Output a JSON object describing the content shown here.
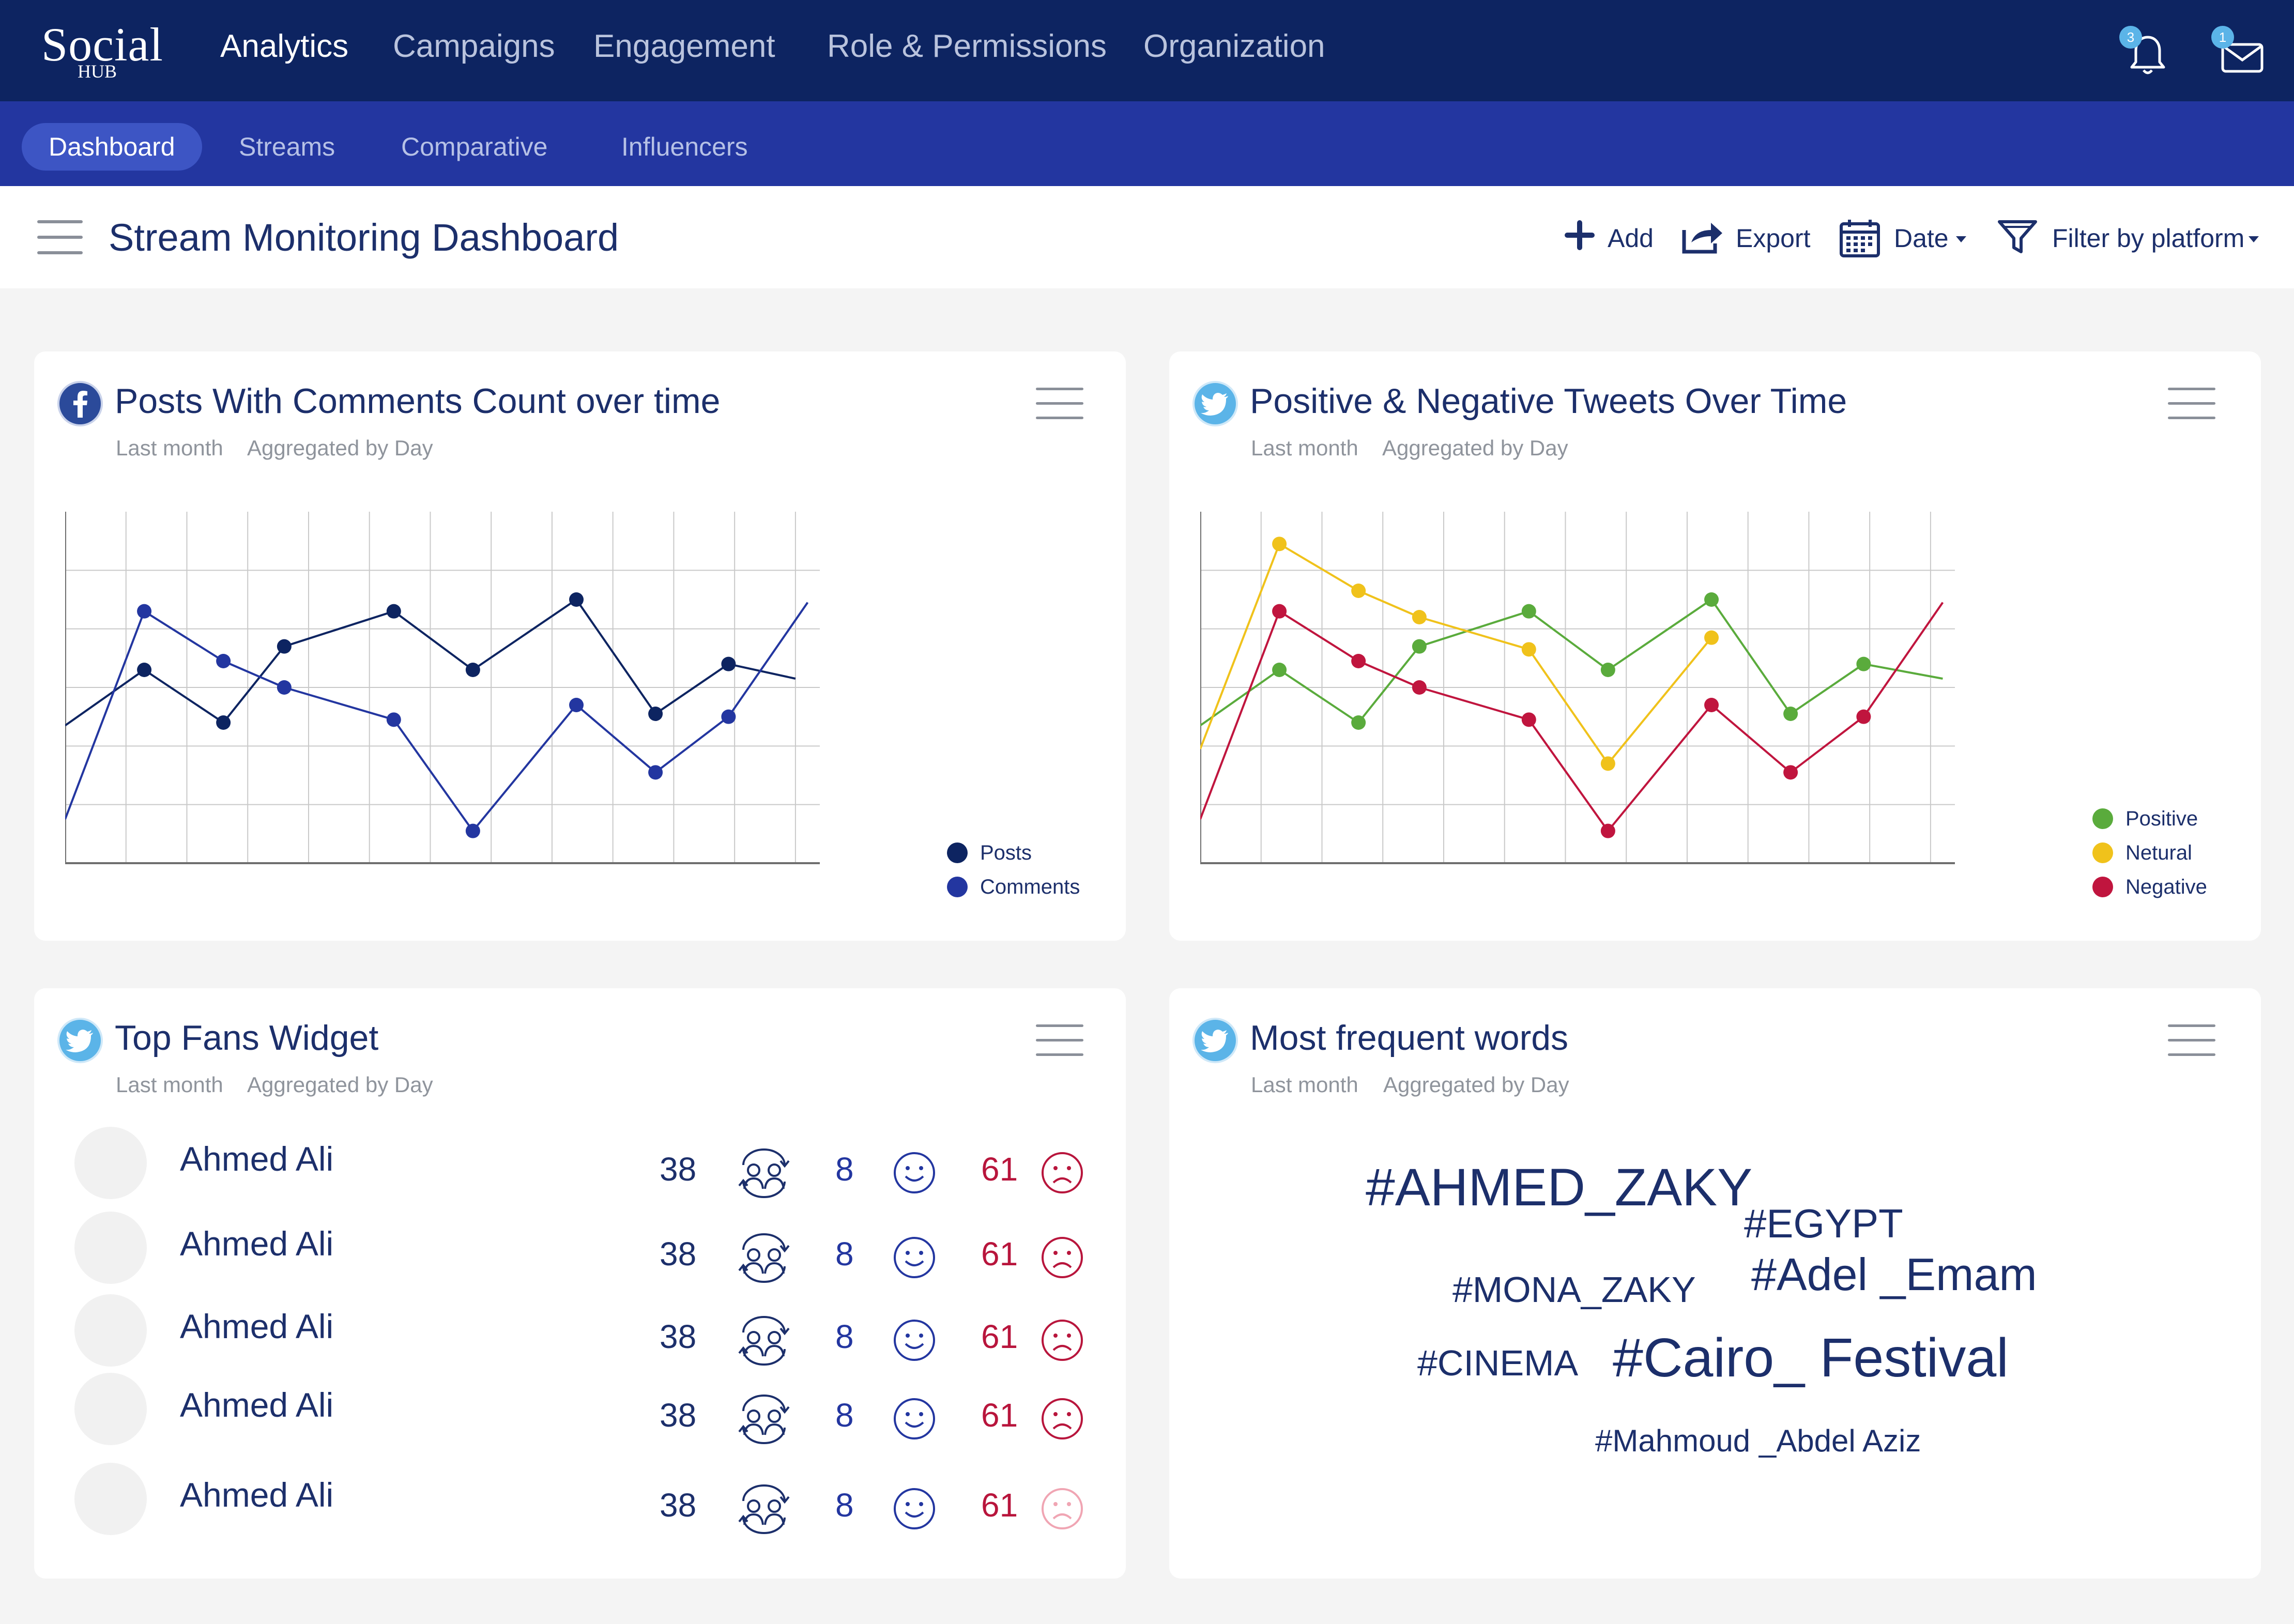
{
  "brand": {
    "logo_main": "Social",
    "logo_sub": "HUB"
  },
  "top_nav": {
    "items": [
      "Analytics",
      "Campaigns",
      "Engagement",
      "Role & Permissions",
      "Organization"
    ],
    "notifications_count": "3",
    "messages_count": "1"
  },
  "sub_nav": {
    "items": [
      "Dashboard",
      "Streams",
      "Comparative",
      "Influencers"
    ]
  },
  "page": {
    "title": "Stream Monitoring Dashboard",
    "actions": {
      "add": "Add",
      "export": "Export",
      "date": "Date",
      "filter": "Filter by platform"
    }
  },
  "cards": {
    "posts_comments": {
      "platform": "facebook",
      "title": "Posts With Comments Count over time",
      "period": "Last month",
      "aggregation": "Aggregated by Day"
    },
    "tweets_sentiment": {
      "platform": "twitter",
      "title": "Positive & Negative Tweets Over Time",
      "period": "Last month",
      "aggregation": "Aggregated by Day"
    },
    "top_fans": {
      "platform": "twitter",
      "title": "Top Fans Widget",
      "period": "Last month",
      "aggregation": "Aggregated by Day"
    },
    "frequent_words": {
      "platform": "twitter",
      "title": "Most frequent words",
      "period": "Last month",
      "aggregation": "Aggregated by Day"
    }
  },
  "chart_data": [
    {
      "type": "line",
      "x": [
        0,
        1,
        2,
        3,
        4,
        5,
        6,
        7,
        8,
        9,
        10,
        11,
        12
      ],
      "xlim": [
        0,
        12.4
      ],
      "ylim": [
        0,
        6
      ],
      "grid": true,
      "legend_position": "bottom-right",
      "series": [
        {
          "name": "Posts",
          "color": "#0d2461",
          "points": [
            [
              0,
              2.35
            ],
            [
              1.3,
              3.3
            ],
            [
              2.6,
              2.4
            ],
            [
              3.6,
              3.7
            ],
            [
              5.4,
              4.3
            ],
            [
              6.7,
              3.3
            ],
            [
              8.4,
              4.5
            ],
            [
              9.7,
              2.55
            ],
            [
              10.9,
              3.4
            ],
            [
              12.0,
              3.15
            ]
          ],
          "markers": [
            1,
            2,
            3,
            4,
            5,
            6,
            7,
            8
          ]
        },
        {
          "name": "Comments",
          "color": "#2336a0",
          "points": [
            [
              0,
              0.75
            ],
            [
              1.3,
              4.3
            ],
            [
              2.6,
              3.45
            ],
            [
              3.6,
              3.0
            ],
            [
              5.4,
              2.45
            ],
            [
              6.7,
              0.55
            ],
            [
              8.4,
              2.7
            ],
            [
              9.7,
              1.55
            ],
            [
              10.9,
              2.5
            ],
            [
              12.2,
              4.45
            ]
          ],
          "markers": [
            1,
            2,
            3,
            4,
            5,
            6,
            7,
            8
          ]
        }
      ]
    },
    {
      "type": "line",
      "x": [
        0,
        1,
        2,
        3,
        4,
        5,
        6,
        7,
        8,
        9,
        10,
        11,
        12
      ],
      "xlim": [
        0,
        12.4
      ],
      "ylim": [
        0,
        6
      ],
      "grid": true,
      "legend_position": "bottom-right",
      "series": [
        {
          "name": "Positive",
          "color": "#5aab3c",
          "points": [
            [
              0,
              2.35
            ],
            [
              1.3,
              3.3
            ],
            [
              2.6,
              2.4
            ],
            [
              3.6,
              3.7
            ],
            [
              5.4,
              4.3
            ],
            [
              6.7,
              3.3
            ],
            [
              8.4,
              4.5
            ],
            [
              9.7,
              2.55
            ],
            [
              10.9,
              3.4
            ],
            [
              12.2,
              3.15
            ]
          ],
          "markers": [
            1,
            2,
            3,
            4,
            5,
            6,
            7,
            8
          ]
        },
        {
          "name": "Netural",
          "color": "#f0c21b",
          "points": [
            [
              0,
              1.95
            ],
            [
              1.3,
              5.45
            ],
            [
              2.6,
              4.65
            ],
            [
              3.6,
              4.2
            ],
            [
              5.4,
              3.65
            ],
            [
              6.7,
              1.7
            ],
            [
              8.4,
              3.85
            ]
          ],
          "markers": [
            1,
            2,
            3,
            4,
            5,
            6
          ]
        },
        {
          "name": "Negative",
          "color": "#c0153e",
          "points": [
            [
              0,
              0.75
            ],
            [
              1.3,
              4.3
            ],
            [
              2.6,
              3.45
            ],
            [
              3.6,
              3.0
            ],
            [
              5.4,
              2.45
            ],
            [
              6.7,
              0.55
            ],
            [
              8.4,
              2.7
            ],
            [
              9.7,
              1.55
            ],
            [
              10.9,
              2.5
            ],
            [
              12.2,
              4.45
            ]
          ],
          "markers": [
            1,
            2,
            3,
            4,
            5,
            6,
            7,
            8
          ]
        }
      ]
    }
  ],
  "top_fans": [
    {
      "name": "Ahmed Ali",
      "followers": "38",
      "positive": "8",
      "negative": "61"
    },
    {
      "name": "Ahmed Ali",
      "followers": "38",
      "positive": "8",
      "negative": "61"
    },
    {
      "name": "Ahmed Ali",
      "followers": "38",
      "positive": "8",
      "negative": "61"
    },
    {
      "name": "Ahmed Ali",
      "followers": "38",
      "positive": "8",
      "negative": "61"
    },
    {
      "name": "Ahmed Ali",
      "followers": "38",
      "positive": "8",
      "negative": "61"
    }
  ],
  "words": [
    "#AHMED_ZAKY",
    "#EGYPT",
    "#MONA_ZAKY",
    "#Adel _Emam",
    "#CINEMA",
    "#Cairo_ Festival",
    "#Mahmoud _Abdel Aziz"
  ],
  "colors": {
    "nav_dark": "#0d2461",
    "nav_blue": "#2336a0",
    "text_navy": "#1c2f6b",
    "negative_red": "#b8153c",
    "twitter_blue": "#5bb4e8",
    "facebook_blue": "#2b4a9a"
  }
}
